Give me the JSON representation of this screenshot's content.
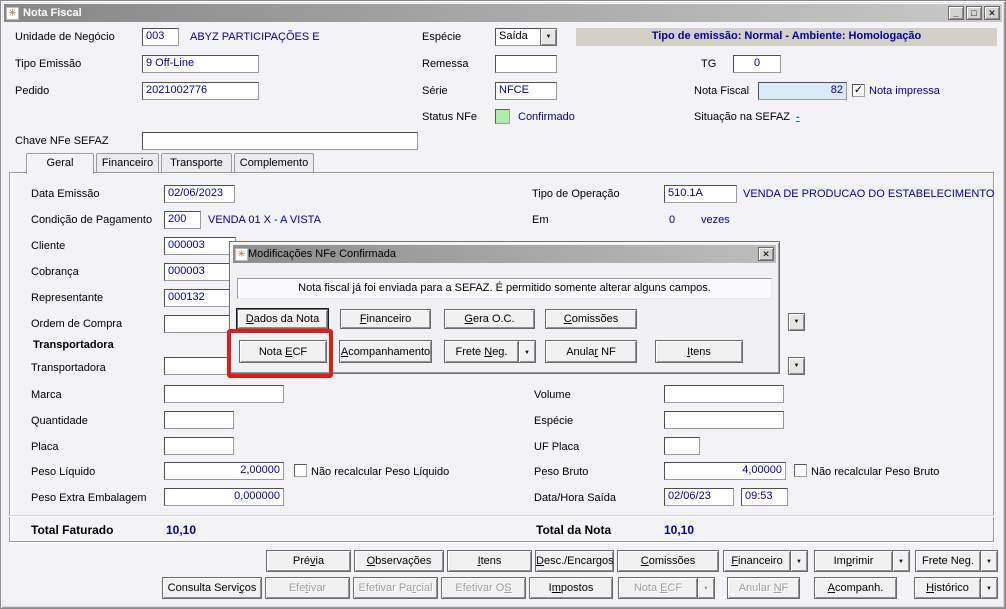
{
  "icons": {
    "app": "✳",
    "dropdown": "▼",
    "close": "✕",
    "check": "✓",
    "maximize": "❒"
  },
  "titlebar": {
    "title": "Nota Fiscal"
  },
  "header": {
    "unidade": {
      "label": "Unidade de Negócio",
      "code": "003",
      "desc": "ABYZ PARTICIPAÇÕES E"
    },
    "tipo_emissao": {
      "label": "Tipo Emissão",
      "value": "9 Off-Line"
    },
    "pedido": {
      "label": "Pedido",
      "value": "2021002776"
    },
    "especie": {
      "label": "Espécie",
      "value": "Saída"
    },
    "remessa": {
      "label": "Remessa",
      "value": ""
    },
    "serie": {
      "label": "Série",
      "value": "NFCE"
    },
    "status_nfe": {
      "label": "Status NFe",
      "value": "Confirmado"
    },
    "banner": "Tipo de emissão: Normal - Ambiente: Homologação",
    "tg": {
      "label": "TG",
      "value": "0"
    },
    "nota_fiscal": {
      "label": "Nota Fiscal",
      "value": "82"
    },
    "nota_impressa": {
      "label": "Nota impressa",
      "checked": true
    },
    "situacao": {
      "label": "Situação na SEFAZ",
      "value": "-"
    },
    "chave": {
      "label": "Chave NFe SEFAZ",
      "value": ""
    }
  },
  "tabs": [
    {
      "label": "Geral",
      "active": true
    },
    {
      "label": "Financeiro",
      "active": false
    },
    {
      "label": "Transporte",
      "active": false
    },
    {
      "label": "Complemento",
      "active": false
    }
  ],
  "geral": {
    "data_emissao": {
      "label": "Data Emissão",
      "value": "02/06/2023"
    },
    "tipo_operacao": {
      "label": "Tipo de Operação",
      "code": "510.1A",
      "desc": "VENDA DE PRODUCAO DO ESTABELECIMENTO"
    },
    "cond_pagamento": {
      "label": "Condição de Pagamento",
      "code": "200",
      "desc": "VENDA 01 X - A VISTA"
    },
    "em": {
      "label": "Em",
      "value": "0",
      "suffix": "vezes"
    },
    "cliente": {
      "label": "Cliente",
      "value": "000003"
    },
    "cobranca": {
      "label": "Cobrança",
      "value": "000003"
    },
    "representante": {
      "label": "Representante",
      "value": "000132"
    },
    "ordem_compra": {
      "label": "Ordem de Compra",
      "value": ""
    },
    "group_title": "Transportadora",
    "transportadora": {
      "label": "Transportadora",
      "value": ""
    },
    "marca": {
      "label": "Marca",
      "value": ""
    },
    "quantidade": {
      "label": "Quantidade",
      "value": ""
    },
    "placa": {
      "label": "Placa",
      "value": ""
    },
    "peso_liquido": {
      "label": "Peso Líquido",
      "value": "2,00000",
      "checkbox": "Não recalcular Peso Líquido"
    },
    "peso_extra": {
      "label": "Peso Extra Embalagem",
      "value": "0,000000"
    },
    "volume": {
      "label": "Volume",
      "value": ""
    },
    "especie2": {
      "label": "Espécie",
      "value": ""
    },
    "uf_placa": {
      "label": "UF Placa",
      "value": ""
    },
    "peso_bruto": {
      "label": "Peso Bruto",
      "value": "4,00000",
      "checkbox": "Não recalcular Peso Bruto"
    },
    "data_hora_saida": {
      "label": "Data/Hora Saída",
      "date": "02/06/23",
      "time": "09:53"
    },
    "total_faturado": {
      "label": "Total Faturado",
      "value": "10,10"
    },
    "total_nota": {
      "label": "Total da Nota",
      "value": "10,10"
    }
  },
  "dialog": {
    "title": "Modificações NFe Confirmada",
    "message": "Nota fiscal já foi enviada para a SEFAZ. É permitido somente alterar alguns campos.",
    "row1": [
      {
        "label": "Dados da Nota",
        "accel": 0
      },
      {
        "label": "Financeiro",
        "accel": 0
      },
      {
        "label": "Gera O.C.",
        "accel": 0
      },
      {
        "label": "Comissões",
        "accel": 0
      }
    ],
    "row2": [
      {
        "label": "Nota ECF",
        "accel": 5
      },
      {
        "label": "Acompanhamento",
        "accel": 0
      },
      {
        "label": "Frete Neg.",
        "accel": 6
      },
      {
        "label": "Anular NF",
        "accel": 5
      },
      {
        "label": "Itens",
        "accel": 0
      }
    ]
  },
  "bottom": {
    "row1": [
      {
        "label": "Prévia",
        "accel": 3
      },
      {
        "label": "Observações",
        "accel": 0
      },
      {
        "label": "Itens",
        "accel": 0
      },
      {
        "label": "Desc./Encargos",
        "accel": 0
      },
      {
        "label": "Comissões",
        "accel": 0
      },
      {
        "label": "Financeiro",
        "accel": 0
      },
      {
        "label": "Imprimir",
        "accel": 2
      },
      {
        "label": "Frete Neg.",
        "accel": 8
      }
    ],
    "row2": [
      {
        "label": "Consulta Serviços",
        "accel": 14
      },
      {
        "label": "Efetivar",
        "accel": 3
      },
      {
        "label": "Efetivar Parcial",
        "accel": 11
      },
      {
        "label": "Efetivar OS",
        "accel": 10
      },
      {
        "label": "Impostos",
        "accel": 1
      },
      {
        "label": "Nota ECF",
        "accel": 5
      },
      {
        "label": "Anular NF",
        "accel": 7
      },
      {
        "label": "Acompanh.",
        "accel": 0
      },
      {
        "label": "Histórico",
        "accel": 0
      }
    ]
  }
}
